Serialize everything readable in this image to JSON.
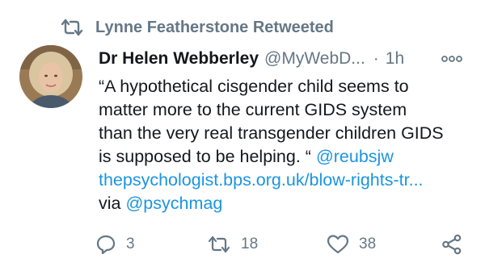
{
  "retweet_banner": {
    "icon": "retweet-icon",
    "label": "Lynne Featherstone Retweeted"
  },
  "tweet": {
    "author_name": "Dr Helen Webberley",
    "author_handle": "@MyWebD...",
    "separator": "·",
    "time": "1h",
    "more_icon": "more-options-icon",
    "text_lines": [
      "“A hypothetical cisgender child seems to",
      "matter more to the current GIDS system",
      "than the very real transgender children GIDS",
      "is supposed to be helping. “ "
    ],
    "mention_1": "@reubsjw",
    "link": "thepsychologist.bps.org.uk/blow-rights-tr...",
    "via_label": "via ",
    "mention_2": "@psychmag"
  },
  "actions": {
    "reply": {
      "icon": "reply-icon",
      "count": "3"
    },
    "retweet": {
      "icon": "retweet-icon",
      "count": "18"
    },
    "like": {
      "icon": "heart-icon",
      "count": "38"
    },
    "share": {
      "icon": "share-icon"
    }
  },
  "colors": {
    "text": "#14171a",
    "secondary": "#657786",
    "link": "#1b95e0",
    "background": "#ffffff"
  }
}
